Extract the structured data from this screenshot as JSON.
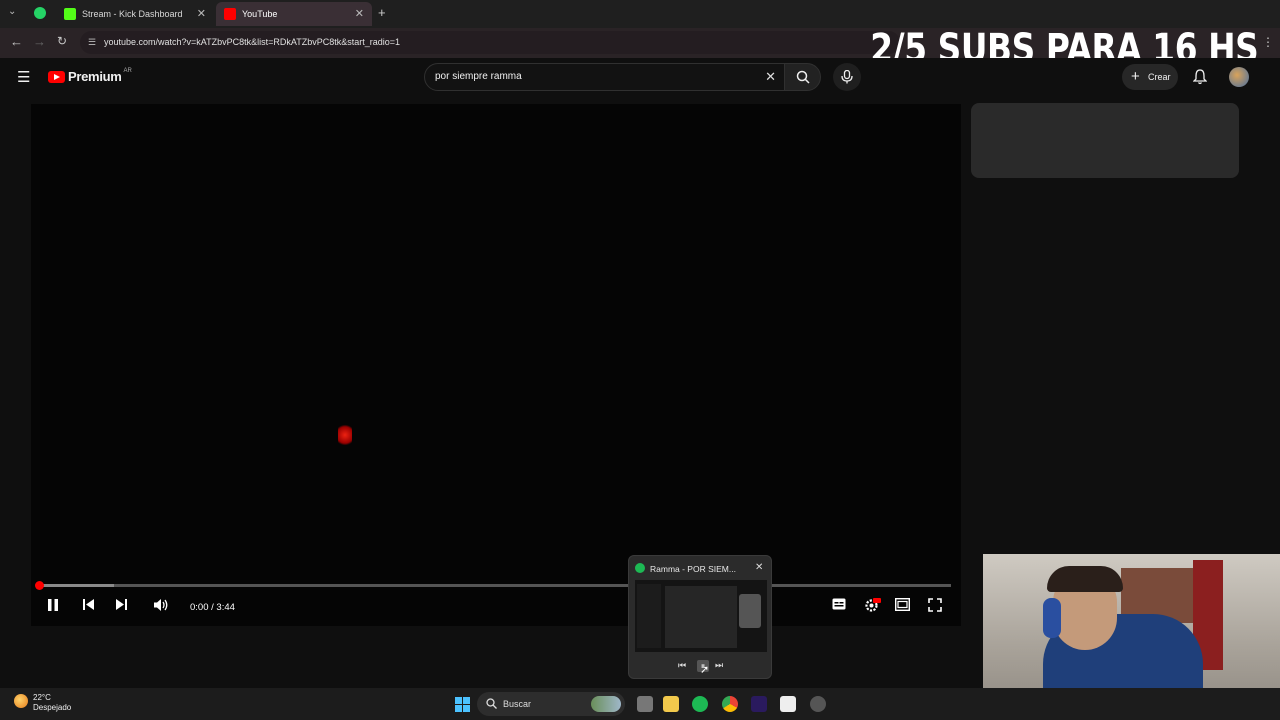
{
  "tabs": [
    {
      "label": "Stream - Kick Dashboard"
    },
    {
      "label": "YouTube"
    }
  ],
  "address": {
    "url": "youtube.com/watch?v=kATZbvPC8tk&list=RDkATZbvPC8tk&start_radio=1"
  },
  "overlay": {
    "text": "2/5 SUBS PARA 16 HS"
  },
  "youtube": {
    "logo_text": "Premium",
    "region": "AR",
    "search_value": "por siempre ramma",
    "create_label": "Crear"
  },
  "player": {
    "time": "0:00 / 3:44"
  },
  "spotify_mini": {
    "title": "Ramma - POR SIEM..."
  },
  "taskbar": {
    "search_label": "Buscar",
    "weather_temp": "22°C",
    "weather_desc": "Despejado"
  },
  "colors": {
    "youtube_red": "#ff0000",
    "spotify_green": "#1db954",
    "kick_green": "#53fc18"
  }
}
